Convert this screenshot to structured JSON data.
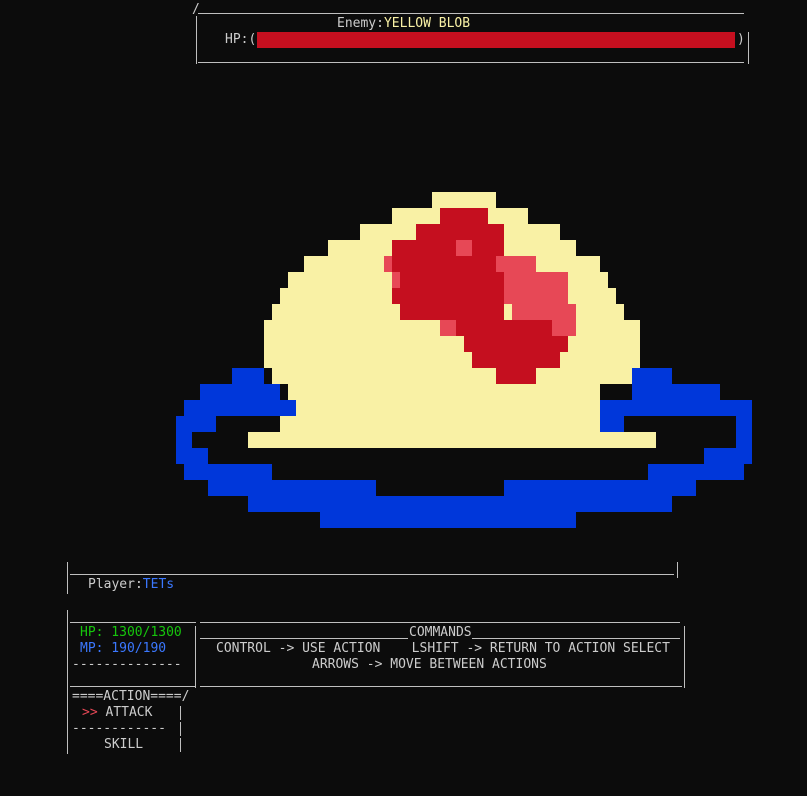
{
  "enemy": {
    "label": "Enemy:",
    "name": "YELLOW BLOB",
    "hp_label": "HP:(",
    "hp_close": ")",
    "hp_fraction": 1.0,
    "hp_color": "#c50f1f"
  },
  "player": {
    "label": "Player:",
    "name": "TETs",
    "hp_text": "HP: 1300/1300",
    "mp_text": "MP: 190/190",
    "colors": {
      "hp": "#16c60c",
      "mp": "#3b78ff",
      "name": "#3b78ff"
    }
  },
  "commands": {
    "title": "COMMANDS",
    "line1": "CONTROL -> USE ACTION    LSHIFT -> RETURN TO ACTION SELECT",
    "line2": "ARROWS -> MOVE BETWEEN ACTIONS"
  },
  "actions": {
    "header": "====ACTION====/",
    "cursor": ">>",
    "items": [
      "ATTACK",
      "SKILL"
    ],
    "selected_index": 0
  },
  "sprite": {
    "name": "yellow-blob",
    "colors": {
      "body": "#f9f1a5",
      "core": "#c50f1f",
      "core_light": "#e74856",
      "ring": "#0037da",
      "background": "#0c0c0c"
    }
  }
}
